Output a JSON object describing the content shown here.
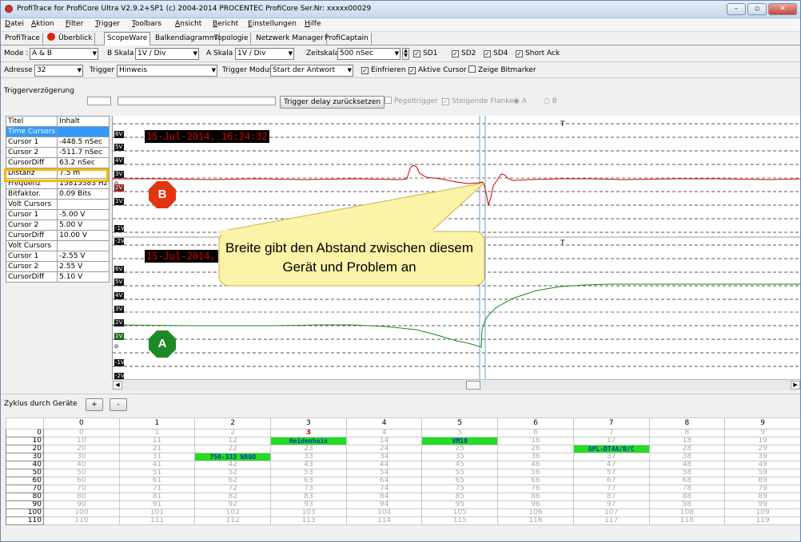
{
  "window": {
    "title": "ProfiTrace for ProfiCore Ultra V2.9.2+SP1 (c) 2004-2014 PROCENTEC  ProfiCore Ser.Nr: xxxxx00029",
    "controls": [
      "–",
      "▫",
      "✕"
    ]
  },
  "menu": [
    "Datei",
    "Aktion",
    "Filter",
    "Trigger",
    "Toolbars",
    "Ansicht",
    "Bericht",
    "Einstellungen",
    "Hilfe"
  ],
  "tabs": [
    "ProfiTrace",
    "Überblick",
    "ScopeWare",
    "Balkendiagramm",
    "Topologie",
    "Netzwerk Manager",
    "ProfiCaptain"
  ],
  "active_tab": "ScopeWare",
  "toolbar1": {
    "mode_label": "Mode :",
    "mode_value": "A & B",
    "bskala_label": "B Skala",
    "bskala_value": "1V / Div",
    "askala_label": "A Skala",
    "askala_value": "1V / Div",
    "zeit_label": "Zeitskala",
    "zeit_value": "500 nSec",
    "checks": [
      {
        "label": "SD1",
        "checked": true
      },
      {
        "label": "SD2",
        "checked": true
      },
      {
        "label": "SD4",
        "checked": true
      },
      {
        "label": "Short Ack",
        "checked": true
      }
    ]
  },
  "toolbar2": {
    "adresse_label": "Adresse",
    "adresse_value": "32",
    "trigger_label": "Trigger",
    "trigger_value": "Hinweis",
    "tmodus_label": "Trigger Modus",
    "tmodus_value": "Start der Antwort",
    "checks": [
      {
        "label": "Einfrieren",
        "checked": true
      },
      {
        "label": "Aktive Cursor",
        "checked": true
      },
      {
        "label": "Zeige Bitmarker",
        "checked": false
      }
    ]
  },
  "toolbar3": {
    "delay_label": "Triggerverzögerung",
    "reset_button": "Trigger delay zurücksetzen",
    "pegel": "Pegeltrigger",
    "flanke": "Steigende Flanke",
    "radio_a": "A",
    "radio_b": "B"
  },
  "properties": {
    "headers": [
      "Titel",
      "Inhalt"
    ],
    "rows": [
      [
        "Time Cursors",
        ""
      ],
      [
        "Cursor 1",
        "-448.5 nSec"
      ],
      [
        "Cursor 2",
        "-511.7 nSec"
      ],
      [
        "CursorDiff",
        "63.2 nSec"
      ],
      [
        "Distanz",
        "7.5 m"
      ],
      [
        "Frequenz",
        "15815383 Hz"
      ],
      [
        "Bitfaktor.",
        "0.09 Bits"
      ],
      [
        "Volt Cursors",
        ""
      ],
      [
        "Cursor 1",
        "-5.00 V"
      ],
      [
        "Cursor 2",
        "5.00 V"
      ],
      [
        "CursorDiff",
        "10.00 V"
      ],
      [
        "Volt Cursors",
        ""
      ],
      [
        "Cursor 1",
        "-2.55 V"
      ],
      [
        "Cursor 2",
        "2.55 V"
      ],
      [
        "CursorDiff",
        "5.10 V"
      ]
    ]
  },
  "scope": {
    "timestamp_b": "15-Jul-2014, 16:24:32",
    "timestamp_a": "15-Jul-2014, 16:24:32",
    "channel_b": "B",
    "channel_a": "A",
    "volt_labels_b": [
      "6V",
      "5V",
      "4V",
      "3V",
      "2V",
      "1V",
      "0",
      "-1V",
      "-2V"
    ],
    "volt_labels_a": [
      "6V",
      "5V",
      "4V",
      "3V",
      "2V",
      "1V",
      "0",
      "-1V",
      "-2V"
    ],
    "trace_b_color": "#cc0000",
    "trace_a_color": "#1a8a1a",
    "callout_text": "Breite gibt den Abstand zwischen diesem Gerät und Problem an",
    "callout_fill": "#fbf3a8"
  },
  "cycle": {
    "label": "Zyklus durch Geräte",
    "plus": "+",
    "minus": "-"
  },
  "devices": {
    "columns": [
      "0",
      "1",
      "2",
      "3",
      "4",
      "5",
      "6",
      "7",
      "8",
      "9"
    ],
    "rows": [
      [
        "0",
        "0",
        "1",
        "2",
        "3",
        "4",
        "5",
        "6",
        "7",
        "8",
        "9"
      ],
      [
        "10",
        "10",
        "11",
        "12",
        "Heidenhain",
        "14",
        "VM10",
        "16",
        "17",
        "18",
        "19"
      ],
      [
        "20",
        "20",
        "21",
        "22",
        "23",
        "24",
        "25",
        "26",
        "GPL-DT4A/B/C",
        "28",
        "29"
      ],
      [
        "30",
        "30",
        "31",
        "750-333 WAGO",
        "33",
        "34",
        "35",
        "36",
        "37",
        "38",
        "39"
      ],
      [
        "40",
        "40",
        "41",
        "42",
        "43",
        "44",
        "45",
        "46",
        "47",
        "48",
        "49"
      ],
      [
        "50",
        "50",
        "51",
        "52",
        "53",
        "54",
        "55",
        "56",
        "57",
        "58",
        "59"
      ],
      [
        "60",
        "60",
        "61",
        "62",
        "63",
        "64",
        "65",
        "66",
        "67",
        "68",
        "69"
      ],
      [
        "70",
        "70",
        "71",
        "72",
        "73",
        "74",
        "75",
        "76",
        "77",
        "78",
        "79"
      ],
      [
        "80",
        "80",
        "81",
        "82",
        "83",
        "84",
        "85",
        "86",
        "87",
        "88",
        "89"
      ],
      [
        "90",
        "90",
        "91",
        "92",
        "93",
        "94",
        "95",
        "96",
        "97",
        "98",
        "99"
      ],
      [
        "100",
        "100",
        "101",
        "102",
        "103",
        "104",
        "105",
        "106",
        "107",
        "108",
        "109"
      ],
      [
        "110",
        "110",
        "111",
        "112",
        "113",
        "114",
        "115",
        "116",
        "117",
        "118",
        "119"
      ]
    ],
    "device_cells": [
      "Heidenhain",
      "VM10",
      "GPL-DT4A/B/C",
      "750-333 WAGO"
    ],
    "highlight_address": "3"
  }
}
